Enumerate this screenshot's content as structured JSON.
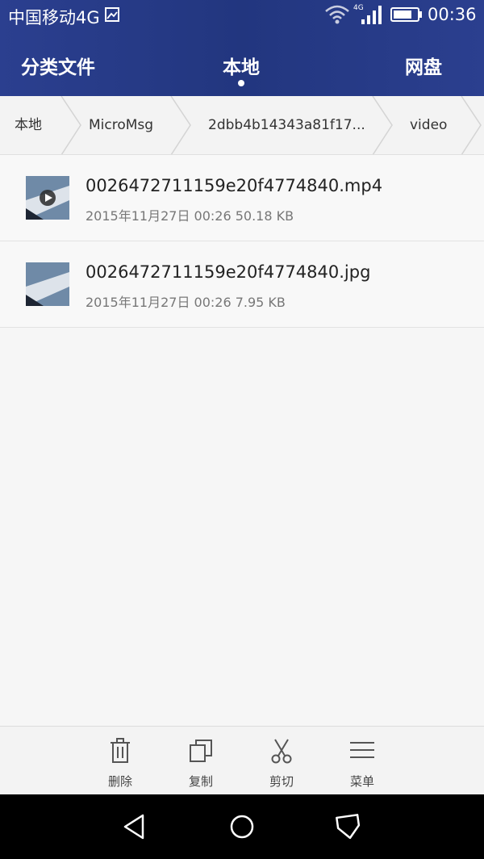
{
  "status_bar": {
    "carrier": "中国移动4G",
    "network_type": "4G",
    "time": "00:36"
  },
  "tabs": [
    {
      "label": "分类文件",
      "selected": false
    },
    {
      "label": "本地",
      "selected": true
    },
    {
      "label": "网盘",
      "selected": false
    }
  ],
  "breadcrumb": [
    "本地",
    "MicroMsg",
    "2dbb4b14343a81f17...",
    "video"
  ],
  "files": [
    {
      "name": "0026472711159e20f4774840.mp4",
      "date": "2015年11月27日 00:26",
      "size": "50.18 KB",
      "meta": "2015年11月27日 00:26 50.18 KB",
      "type": "video"
    },
    {
      "name": "0026472711159e20f4774840.jpg",
      "date": "2015年11月27日 00:26",
      "size": "7.95 KB",
      "meta": "2015年11月27日 00:26 7.95 KB",
      "type": "image"
    }
  ],
  "toolbar": {
    "delete_label": "删除",
    "copy_label": "复制",
    "cut_label": "剪切",
    "menu_label": "菜单"
  },
  "colors": {
    "header": "#22367f",
    "background": "#f6f6f6"
  }
}
